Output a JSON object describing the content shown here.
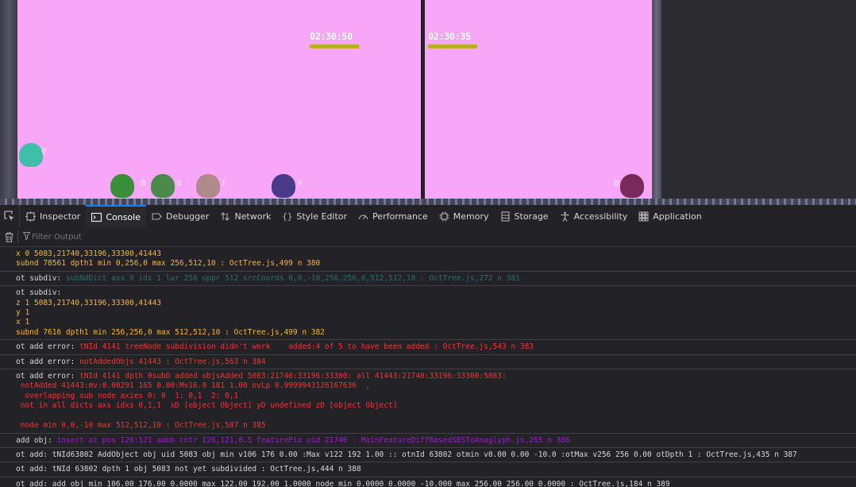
{
  "viewport": {
    "left_timestamp": "02:30:50",
    "right_timestamp": "02:30:35",
    "blobs": [
      {
        "name": "teal-blob",
        "color": "#3fbfa8",
        "tag": "0"
      },
      {
        "name": "green-blob-1",
        "color": "#3a8f3a",
        "tag": "0"
      },
      {
        "name": "green-blob-2",
        "color": "#4b8a4b",
        "tag": "0"
      },
      {
        "name": "pink-blob",
        "color": "#b08a8a",
        "tag": "1"
      },
      {
        "name": "indigo-blob",
        "color": "#4a3a8a",
        "tag": "4"
      },
      {
        "name": "maroon-blob",
        "color": "#7a2a5a",
        "tag": "0"
      }
    ]
  },
  "devtools": {
    "tabs": [
      {
        "label": "Inspector",
        "icon": "inspector-icon"
      },
      {
        "label": "Console",
        "icon": "console-icon"
      },
      {
        "label": "Debugger",
        "icon": "debugger-icon"
      },
      {
        "label": "Network",
        "icon": "network-icon"
      },
      {
        "label": "Style Editor",
        "icon": "style-editor-icon"
      },
      {
        "label": "Performance",
        "icon": "performance-icon"
      },
      {
        "label": "Memory",
        "icon": "memory-icon"
      },
      {
        "label": "Storage",
        "icon": "storage-icon"
      },
      {
        "label": "Accessibility",
        "icon": "accessibility-icon"
      },
      {
        "label": "Application",
        "icon": "application-icon"
      }
    ],
    "active_tab": "Console",
    "filter_placeholder": "Filter Output"
  },
  "console": {
    "messages": [
      {
        "lines": [
          [
            {
              "t": "x 0 5083,21740,33196,33300,41443",
              "c": "orange"
            }
          ],
          [
            {
              "t": "subnd 78561 dpth1 min 0,256,0 max 256,512,10 : OctTree.js,499 n 380",
              "c": "orange"
            }
          ]
        ]
      },
      {
        "lines": [
          [
            {
              "t": "ot subdiv: ",
              "c": "def"
            },
            {
              "t": "subNdDict axs 0 idx 1 lwr 256 uppr 512 srcCoords 0,0,-10,256,256,0,512,512,10 : OctTree.js,272 n 381",
              "c": "teal"
            }
          ]
        ]
      },
      {
        "lines": [
          [
            {
              "t": "ot subdiv:",
              "c": "def"
            }
          ],
          [
            {
              "t": "z 1 5083,21740,33196,33300,41443",
              "c": "orange"
            }
          ],
          [
            {
              "t": "y 1",
              "c": "orange"
            }
          ],
          [
            {
              "t": "x 1",
              "c": "orange"
            }
          ],
          [
            {
              "t": "subnd 7616 dpth1 min 256,256,0 max 512,512,10 : OctTree.js,499 n 382",
              "c": "orange"
            }
          ]
        ]
      },
      {
        "lines": [
          [
            {
              "t": "ot add error: ",
              "c": "def"
            },
            {
              "t": "tNId 4141 treeNode subdivision didn't work    added:4 of 5 to have been added : OctTree.js,543 n 383",
              "c": "red"
            }
          ]
        ]
      },
      {
        "lines": [
          [
            {
              "t": "ot add error: ",
              "c": "def"
            },
            {
              "t": "notAddedObjs 41443 : OctTree.js,563 n 384",
              "c": "red"
            }
          ]
        ]
      },
      {
        "lines": [
          [
            {
              "t": "ot add error: ",
              "c": "def"
            },
            {
              "t": "tNId 4141 dpth 0subD added objsAdded 5083:21740:33196:33300: all 41443:21740:33196:33300:5083:",
              "c": "red"
            }
          ],
          [
            {
              "t": " notAdded 41443:mv:0.00291 165 0.00:Mv16.0 181 1.00 ovLp 0.9999943126167636  ,",
              "c": "red"
            }
          ],
          [
            {
              "t": "  overlapping sub node axies 0: 0  1: 0,1  2: 0,1",
              "c": "red"
            }
          ],
          [
            {
              "t": " not in all dicts axs idxs 0,1,1  xD [object Object] yD undefined zD [object Object]",
              "c": "red"
            }
          ],
          [
            {
              "t": " ",
              "c": "red"
            }
          ],
          [
            {
              "t": " node min 0,0,-10 max 512,512,10 : OctTree.js,587 n 385",
              "c": "red"
            }
          ]
        ]
      },
      {
        "lines": [
          [
            {
              "t": "add obj: ",
              "c": "def"
            },
            {
              "t": "insert at pos 126:121 aabb cntr 126,121,0.5 featurePix uid 21740 : MainFeatureDiffBasedSBSToAnaglyph.js,265 n 386",
              "c": "purple"
            }
          ]
        ]
      },
      {
        "lines": [
          [
            {
              "t": "ot add: tNId63802 AddObject obj uid 5083 obj min v106 176 0.00 :Max v122 192 1.00 :: otnId 63802 otmin v0.00 0.00 -10.0 :otMax v256 256 0.00 otDpth 1 : OctTree.js,435 n 387",
              "c": "def"
            }
          ]
        ]
      },
      {
        "lines": [
          [
            {
              "t": "ot add: tNId 63802 dpth 1 obj 5083 not yet subdivided : OctTree.js,444 n 388",
              "c": "def"
            }
          ]
        ]
      },
      {
        "lines": [
          [
            {
              "t": "ot add: add obj min 106.00 176.00 0.0000 max 122.00 192.00 1.0000 node min 0.0000 0.0000 -10.000 max 256.00 256.00 0.0000 : OctTree.js,184 n 389",
              "c": "def"
            }
          ]
        ]
      }
    ]
  }
}
